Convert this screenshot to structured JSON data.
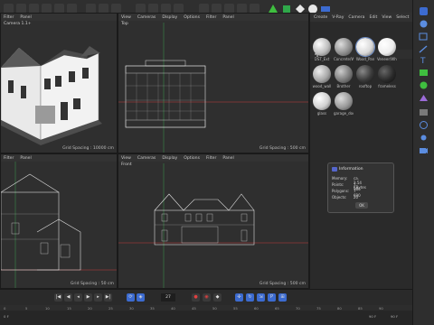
{
  "top_toolbar": {
    "colors": {
      "green": "#3fbf3f",
      "blue": "#3c6bd0",
      "white": "#e8e8e8"
    }
  },
  "viewports": {
    "perspective": {
      "menu": [
        "Filter",
        "Panel"
      ],
      "name": "Camera 1.1+",
      "grid_spacing": "Grid Spacing : 10000 cm"
    },
    "top": {
      "menu": [
        "View",
        "Cameras",
        "Display",
        "Options",
        "Filter",
        "Panel"
      ],
      "name": "Top",
      "grid_spacing": "Grid Spacing : 500 cm"
    },
    "right": {
      "menu": [
        "Filter",
        "Panel"
      ],
      "name": "",
      "grid_spacing": "Grid Spacing : 50 cm"
    },
    "front": {
      "menu": [
        "View",
        "Cameras",
        "Display",
        "Options",
        "Filter",
        "Panel"
      ],
      "name": "Front",
      "grid_spacing": "Grid Spacing : 500 cm"
    }
  },
  "material_manager": {
    "menu": [
      "Create",
      "V-Ray",
      "Camera",
      "Edit",
      "View",
      "Select"
    ],
    "materials": [
      {
        "label": "DST_Ext",
        "color": "#bdbdbd"
      },
      {
        "label": "Concrete/Wi",
        "color": "#8f8f8f"
      },
      {
        "label": "Wood_Pan",
        "color": "#d9d9d9",
        "selected": true
      },
      {
        "label": "Veneer/Whit",
        "color": "#ededed"
      },
      {
        "label": "wood_wall",
        "color": "#a7a7a7"
      },
      {
        "label": "Brother",
        "color": "#7a7a7a"
      },
      {
        "label": "rooftop",
        "color": "#3a3a3a"
      },
      {
        "label": "frameless",
        "color": "#2a2a2a"
      },
      {
        "label": "glass",
        "color": "#d0d0d0"
      },
      {
        "label": "garage_door",
        "color": "#9a9a9a"
      }
    ]
  },
  "info_dialog": {
    "title": "Information",
    "rows": [
      {
        "label": "Memory:",
        "value": "ca. 2.54 KBytes"
      },
      {
        "label": "Points:",
        "value": "7 386"
      },
      {
        "label": "Polygons:",
        "value": "7 690"
      },
      {
        "label": "Objects:",
        "value": "20"
      }
    ],
    "ok_label": "OK"
  },
  "timeline": {
    "frame_field": "27",
    "ruler_ticks": [
      "0",
      "5",
      "10",
      "15",
      "20",
      "25",
      "30",
      "35",
      "40",
      "45",
      "50",
      "55",
      "60",
      "65",
      "70",
      "75",
      "80",
      "85",
      "90"
    ],
    "status_left": "0 F",
    "status_values": [
      "90 F",
      "90 F"
    ]
  },
  "sidebar_icons": [
    "cube-icon",
    "sphere-icon",
    "spline-icon",
    "pen-icon",
    "text-icon",
    "extrude-icon",
    "subdivide-icon",
    "deformer-icon",
    "field-icon",
    "globe-icon",
    "light-icon",
    "camera-icon"
  ]
}
